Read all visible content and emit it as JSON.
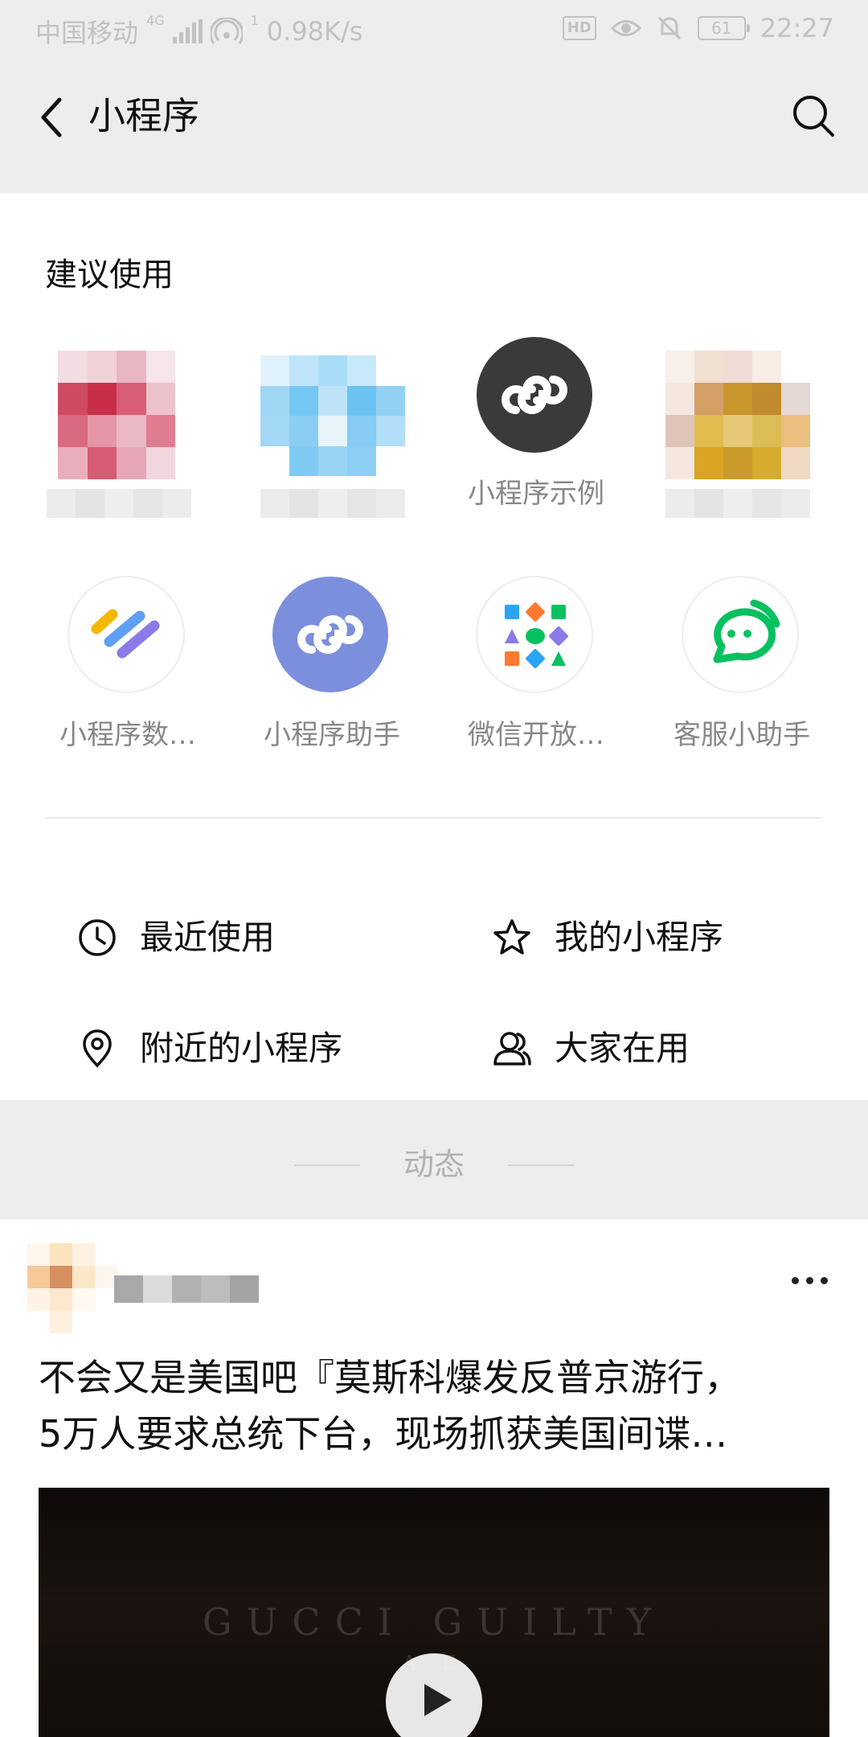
{
  "status_bar": {
    "carrier": "中国移动",
    "network_type": "4G",
    "hotspot_count": "1",
    "speed": "0.98K/s",
    "hd_badge": "HD",
    "battery": "61",
    "time": "22:27"
  },
  "nav": {
    "title": "小程序",
    "back_icon": "chevron-left-icon",
    "search_icon": "search-icon"
  },
  "suggested": {
    "title": "建议使用",
    "apps": [
      {
        "label": "",
        "blurred": true
      },
      {
        "label": "",
        "blurred": true
      },
      {
        "label": "小程序示例",
        "icon": "mini-program-icon",
        "color": "#3a3a3a"
      },
      {
        "label": "",
        "blurred": true
      },
      {
        "label": "小程序数…",
        "icon": "data-stripes-icon"
      },
      {
        "label": "小程序助手",
        "icon": "mini-program-icon",
        "color": "#7b8fdc"
      },
      {
        "label": "微信开放…",
        "icon": "shapes-grid-icon"
      },
      {
        "label": "客服小助手",
        "icon": "chat-bubble-icon",
        "color": "#07c160"
      }
    ]
  },
  "quick_links": [
    {
      "label": "最近使用",
      "icon": "clock-icon"
    },
    {
      "label": "我的小程序",
      "icon": "star-icon"
    },
    {
      "label": "附近的小程序",
      "icon": "location-pin-icon"
    },
    {
      "label": "大家在用",
      "icon": "people-icon"
    }
  ],
  "feed": {
    "title": "动态",
    "post": {
      "title_line1": "不会又是美国吧『莫斯科爆发反普京游行，",
      "title_line2": "5万人要求总统下台，现场抓获美国间谍…",
      "video_brand": "GUCCI GUILTY",
      "video_sub": "A  E"
    }
  }
}
